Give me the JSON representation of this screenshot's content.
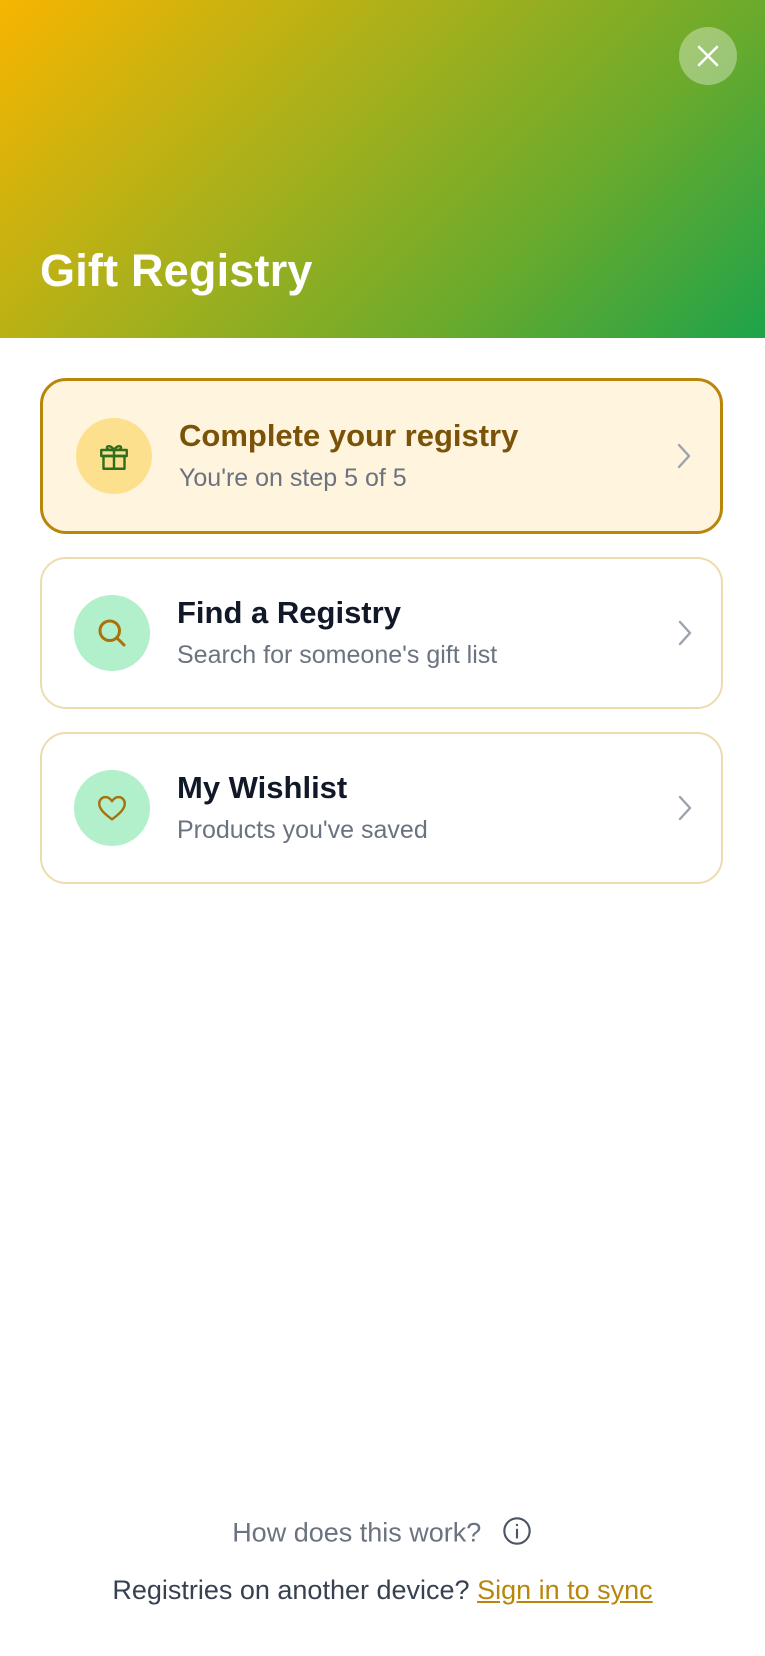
{
  "header": {
    "title": "Gift Registry",
    "close_icon": "close-icon",
    "gradient_colors": [
      "#f7b500",
      "#1ea34a"
    ]
  },
  "cards": [
    {
      "title": "Complete your registry",
      "subtitle": "You're on step 5 of 5",
      "icon": "gift-icon",
      "active": true,
      "progress": {
        "step": 5,
        "total": 5
      }
    },
    {
      "title": "Find a Registry",
      "subtitle": "Search for someone's gift list",
      "icon": "search-icon",
      "active": false
    },
    {
      "title": "My Wishlist",
      "subtitle": "Products you've saved",
      "icon": "heart-icon",
      "active": false
    }
  ],
  "footer": {
    "help_text": "How does this work?",
    "help_icon": "info-icon",
    "sync_prompt": "Registries on another device?",
    "sync_link": "Sign in to sync"
  },
  "colors": {
    "accent": "#b8860b",
    "active_card_bg": "#fff4dd",
    "icon_bg_gold": "#fde08e",
    "icon_bg_mint": "#b1f0ca"
  }
}
